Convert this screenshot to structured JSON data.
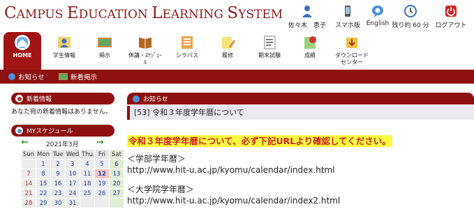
{
  "app": {
    "title_parts": [
      {
        "text": "C",
        "size": "big"
      },
      {
        "text": "AMPUS ",
        "size": "small"
      },
      {
        "text": "E",
        "size": "big"
      },
      {
        "text": "DUCATION ",
        "size": "small"
      },
      {
        "text": "L",
        "size": "big"
      },
      {
        "text": "EARNING ",
        "size": "small"
      },
      {
        "text": "S",
        "size": "big"
      },
      {
        "text": "YSTEM",
        "size": "small"
      }
    ]
  },
  "utilities": {
    "user": "佐々木　恵子",
    "mobile": "スマホ版",
    "english": "English",
    "remaining": "残り約 60 分",
    "logout": "ログアウト"
  },
  "nav": {
    "home": "HOME",
    "student_info": "学生情報",
    "bulletin": "掲示",
    "cancellation_1": "休講・ｽｹｼﾞｭｰ",
    "cancellation_2": "ﾙ",
    "syllabus": "シラバス",
    "registration": "履修",
    "exam": "期末試験",
    "grades": "成績",
    "download_1": "ダウンロード",
    "download_2": "センター"
  },
  "subbar": {
    "notice": "お知らせ",
    "new_posts": "新着掲示"
  },
  "left": {
    "news_title": "新着情報",
    "news_text": "あなた宛の新着情報はありません。",
    "schedule_title": "MYスケジュール",
    "month": "2021年3月",
    "weekdays": [
      "Sun",
      "Mon",
      "Tue",
      "Wed",
      "Thu",
      "Fri",
      "Sat"
    ],
    "weeks": [
      [
        "",
        "1",
        "2",
        "3",
        "4",
        "5",
        "6"
      ],
      [
        "7",
        "8",
        "9",
        "10",
        "11",
        "12",
        "13"
      ],
      [
        "14",
        "15",
        "16",
        "17",
        "18",
        "19",
        "20"
      ],
      [
        "21",
        "22",
        "23",
        "24",
        "25",
        "26",
        "27"
      ],
      [
        "28",
        "29",
        "30",
        "31",
        "",
        "",
        ""
      ]
    ],
    "today": "12"
  },
  "main": {
    "section_title": "お知らせ",
    "notice_title": "[53]  令和３年度学年暦について",
    "headline": "令和３年度学年暦について、必ず下記URLより確認してください。",
    "undergrad_label": "＜学部学年暦＞",
    "undergrad_url": "http://www.hit-u.ac.jp/kyomu/calendar/index.html",
    "grad_label": "＜大学院学年暦＞",
    "grad_url": "http://www.hit-u.ac.jp/kyomu/calendar/index2.html"
  },
  "colors": {
    "brand": "#8e1010",
    "highlight_bg": "#ffff40",
    "highlight_text": "#d02020",
    "today_bg": "#f4c6c6"
  }
}
